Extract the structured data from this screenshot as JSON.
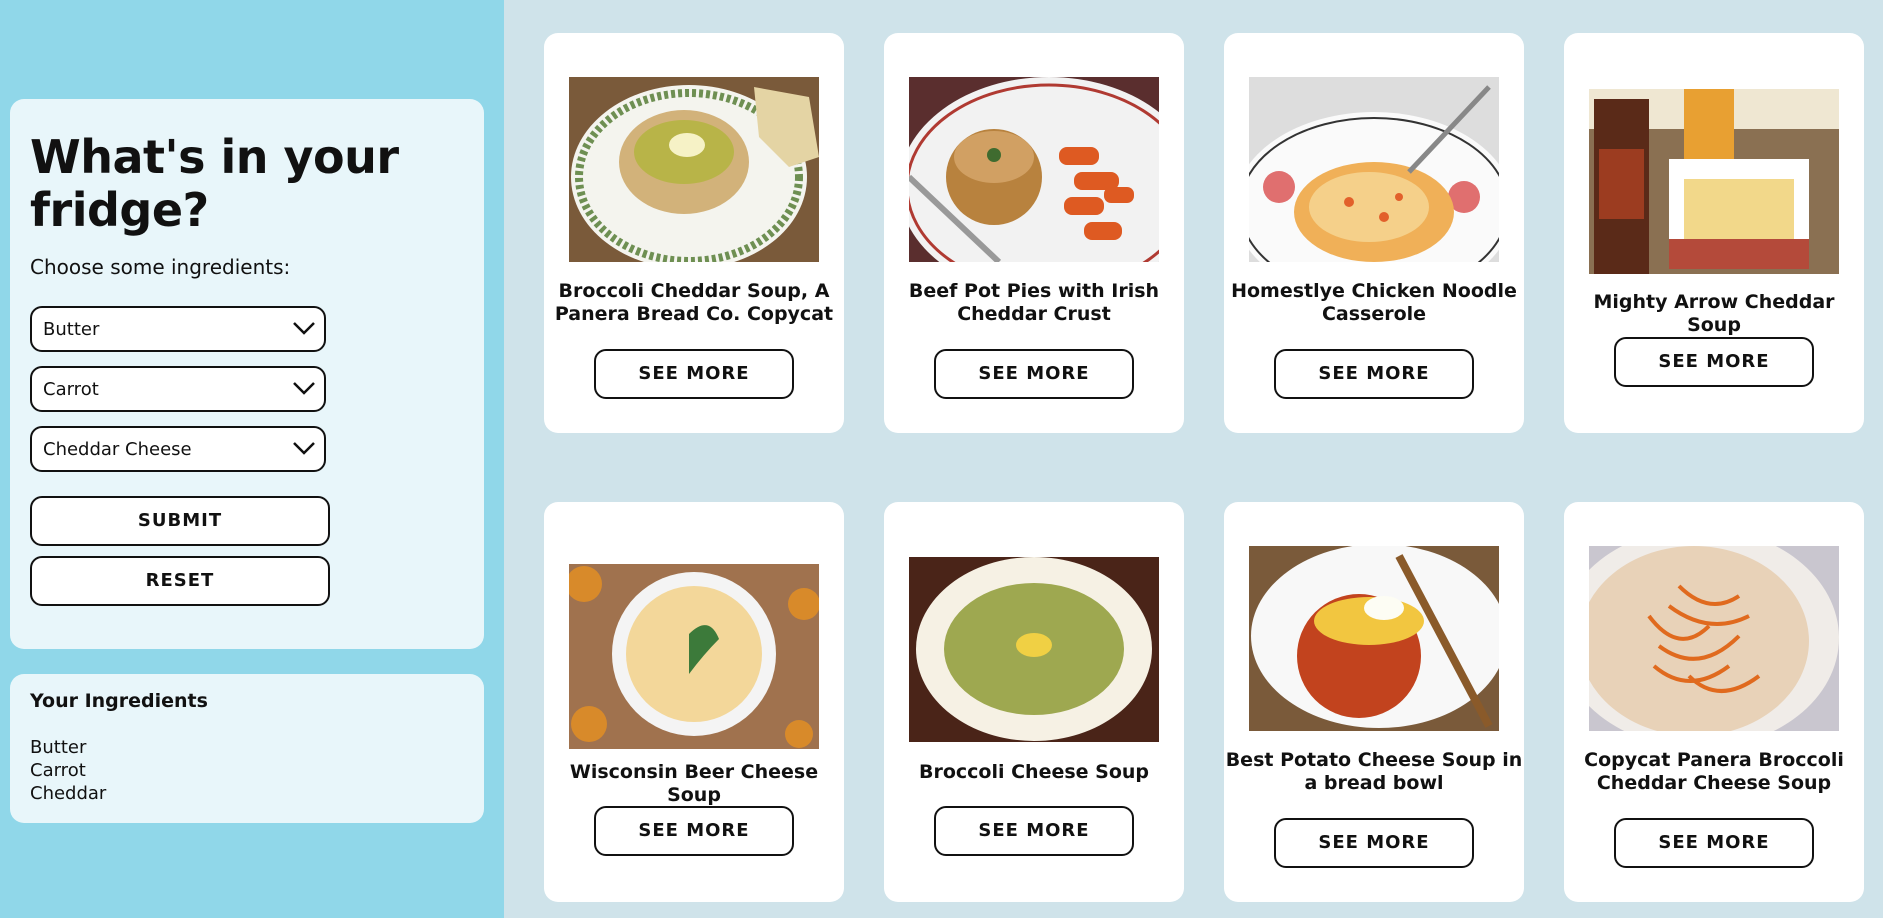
{
  "sidebar": {
    "title": "What's in your fridge?",
    "subtitle": "Choose some ingredients:",
    "selects": [
      {
        "value": "Butter"
      },
      {
        "value": "Carrot"
      },
      {
        "value": "Cheddar Cheese"
      }
    ],
    "submit_label": "SUBMIT",
    "reset_label": "RESET",
    "ingredients_title": "Your Ingredients",
    "ingredients": [
      "Butter",
      "Carrot",
      "Cheddar"
    ]
  },
  "recipes": [
    {
      "title": "Broccoli Cheddar Soup, A Panera Bread Co. Copycat",
      "button": "SEE MORE"
    },
    {
      "title": "Beef Pot Pies with Irish Cheddar Crust",
      "button": "SEE MORE"
    },
    {
      "title": "Homestlye Chicken Noodle Casserole",
      "button": "SEE MORE"
    },
    {
      "title": "Mighty Arrow Cheddar Soup",
      "button": "SEE MORE"
    },
    {
      "title": "Wisconsin Beer Cheese Soup",
      "button": "SEE MORE"
    },
    {
      "title": "Broccoli Cheese Soup",
      "button": "SEE MORE"
    },
    {
      "title": "Best Potato Cheese Soup in a bread bowl",
      "button": "SEE MORE"
    },
    {
      "title": "Copycat Panera Broccoli Cheddar Cheese Soup",
      "button": "SEE MORE"
    }
  ],
  "colors": {
    "sidebar_bg": "#90d7e9",
    "main_bg": "#cfe3ea",
    "panel_bg": "#e8f6fa",
    "card_bg": "#ffffff"
  }
}
